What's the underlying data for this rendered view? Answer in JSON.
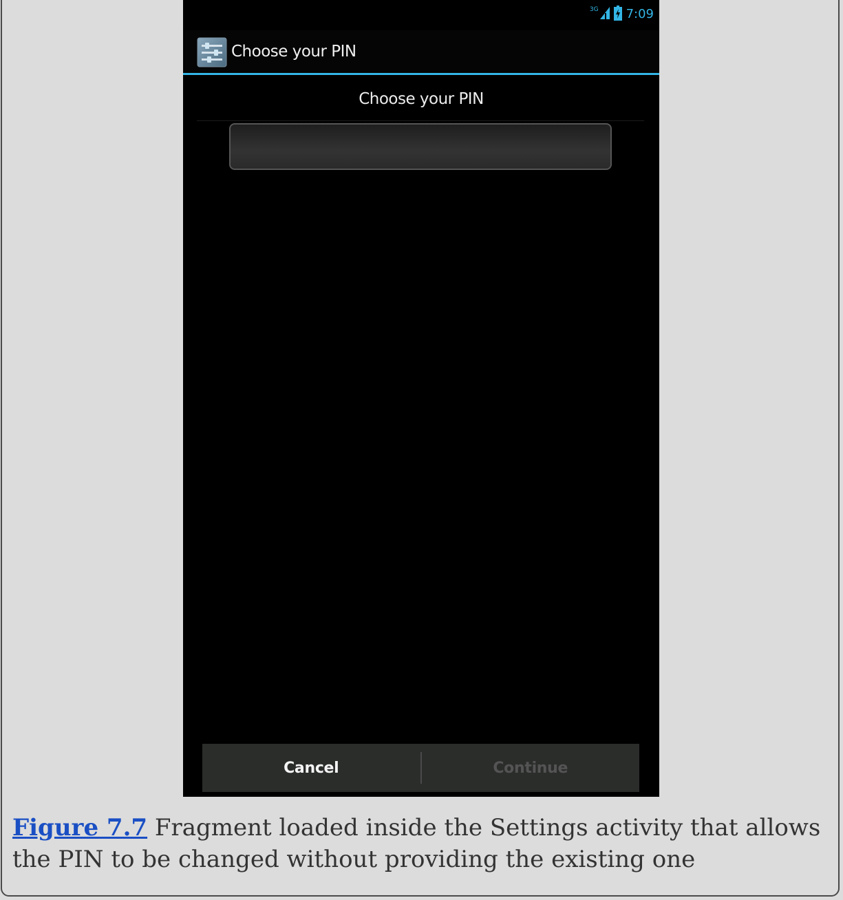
{
  "status_bar": {
    "network_type": "3G",
    "time": "7:09",
    "accent_color": "#33b5e5"
  },
  "action_bar": {
    "icon": "settings-app-icon",
    "title": "Choose your PIN"
  },
  "pin_screen": {
    "header": "Choose your PIN",
    "pin_value": "",
    "cancel_label": "Cancel",
    "continue_label": "Continue",
    "continue_enabled": false
  },
  "caption": {
    "figure_ref": "Figure 7.7",
    "text": " Fragment loaded inside the Settings activity that allows the PIN to be changed without providing the existing one"
  }
}
